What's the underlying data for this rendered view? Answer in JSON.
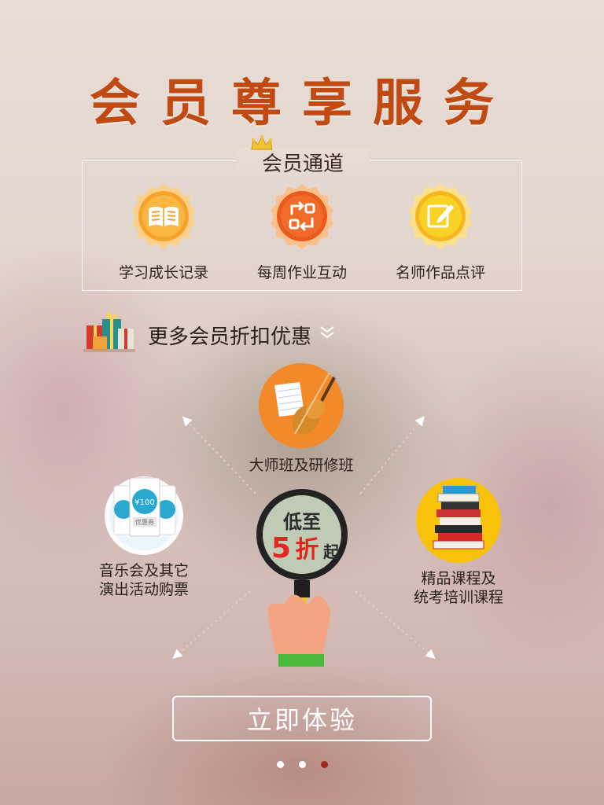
{
  "header": {
    "title": "会员尊享服务"
  },
  "channel": {
    "title": "会员通道",
    "items": [
      {
        "label": "学习成长记录",
        "icon": "book-icon",
        "color": "#f7a12a"
      },
      {
        "label": "每周作业互动",
        "icon": "refresh-icon",
        "color": "#ea5a1e"
      },
      {
        "label": "名师作品点评",
        "icon": "edit-icon",
        "color": "#f7c71f"
      }
    ]
  },
  "discounts": {
    "title": "更多会员折扣优惠",
    "center": {
      "line1": "低至",
      "number": "5",
      "unit": "折",
      "suffix": "起"
    },
    "coupon_value": "¥100",
    "coupon_text": "优惠券",
    "items": [
      {
        "label": "大师班及研修班",
        "icon": "violin-icon"
      },
      {
        "label_line1": "音乐会及其它",
        "label_line2": "演出活动购票",
        "icon": "ticket-icon"
      },
      {
        "label_line1": "精品课程及",
        "label_line2": "统考培训课程",
        "icon": "books-icon"
      }
    ]
  },
  "cta": {
    "label": "立即体验"
  },
  "pagination": {
    "count": 3,
    "active": 3
  },
  "colors": {
    "title": "#c04a12",
    "accent": "#e7231e",
    "dot_active": "#9e2a18"
  }
}
